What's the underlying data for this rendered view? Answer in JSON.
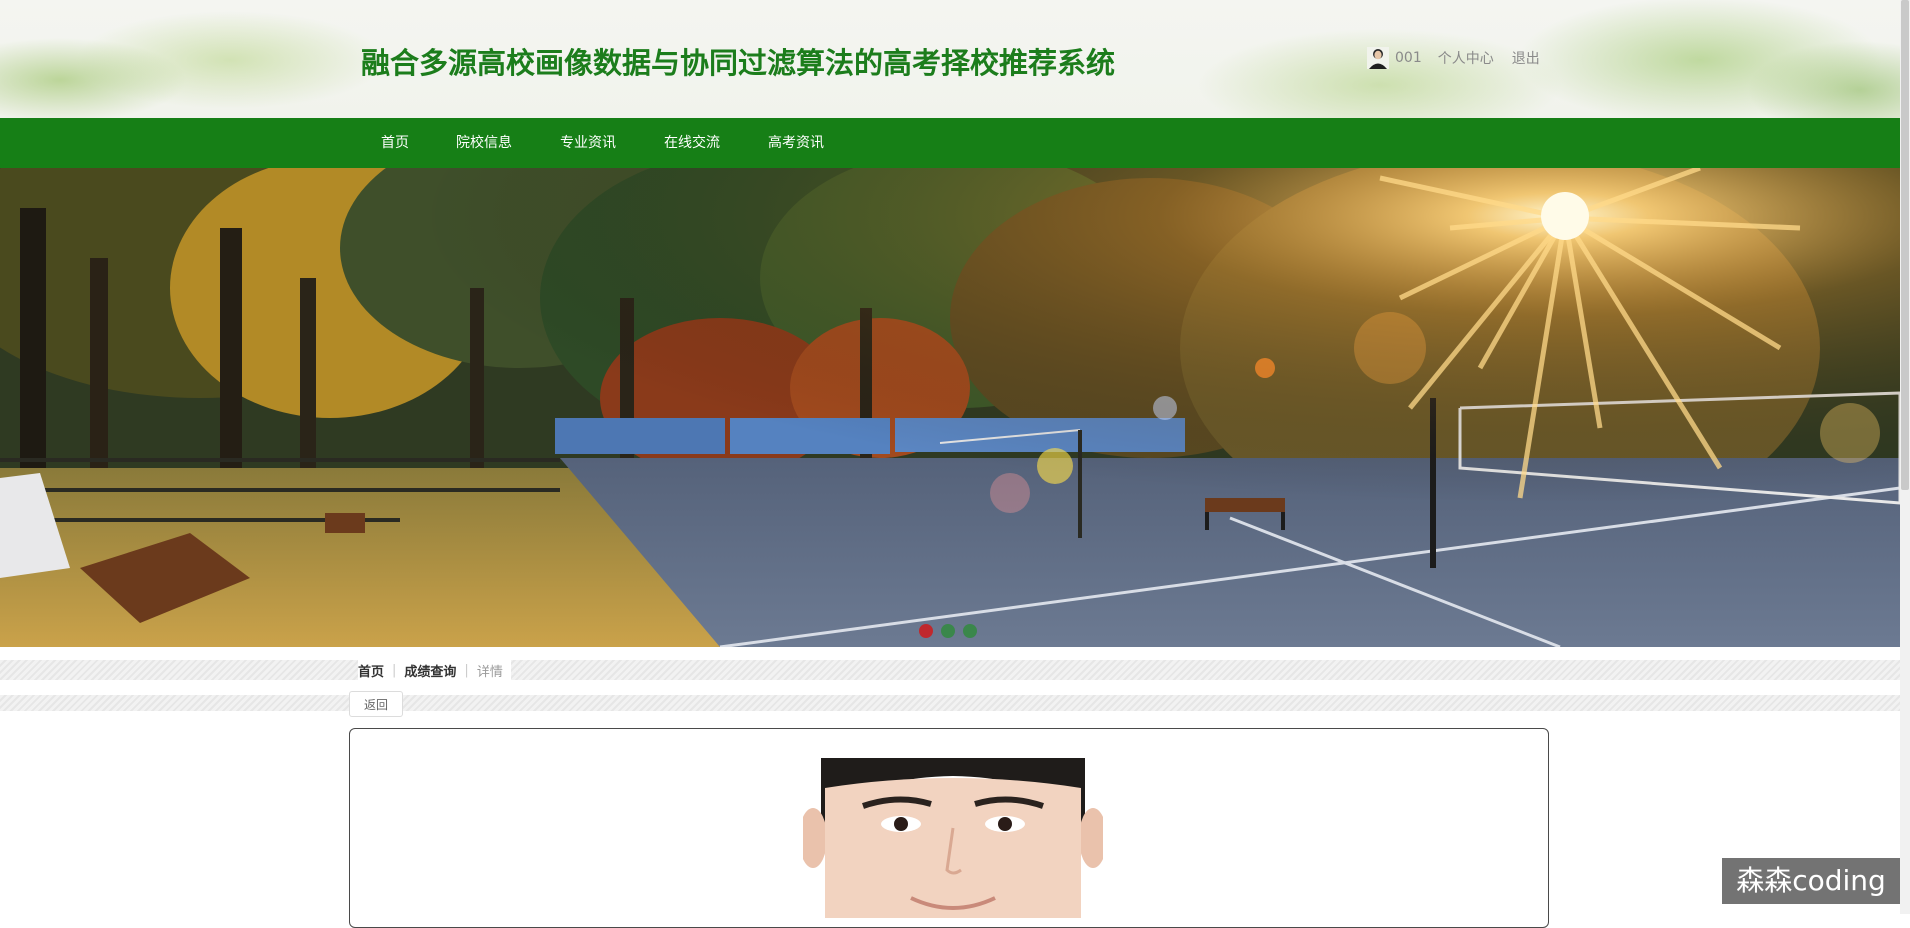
{
  "header": {
    "title": "融合多源高校画像数据与协同过滤算法的高考择校推荐系统",
    "username": "001",
    "profile_link": "个人中心",
    "logout_link": "退出"
  },
  "nav": {
    "items": [
      "首页",
      "院校信息",
      "专业资讯",
      "在线交流",
      "高考资讯"
    ]
  },
  "banner": {
    "slide_count": 3,
    "active_slide": 1,
    "dot_active_color": "#c0282d",
    "dot_inactive_color": "#2e8b3a"
  },
  "breadcrumb": {
    "home": "首页",
    "section": "成绩查询",
    "current": "详情"
  },
  "actions": {
    "back_label": "返回"
  },
  "watermark": {
    "text": "森森coding"
  },
  "colors": {
    "brand_green": "#167f16",
    "title_green": "#1c7d1c"
  }
}
